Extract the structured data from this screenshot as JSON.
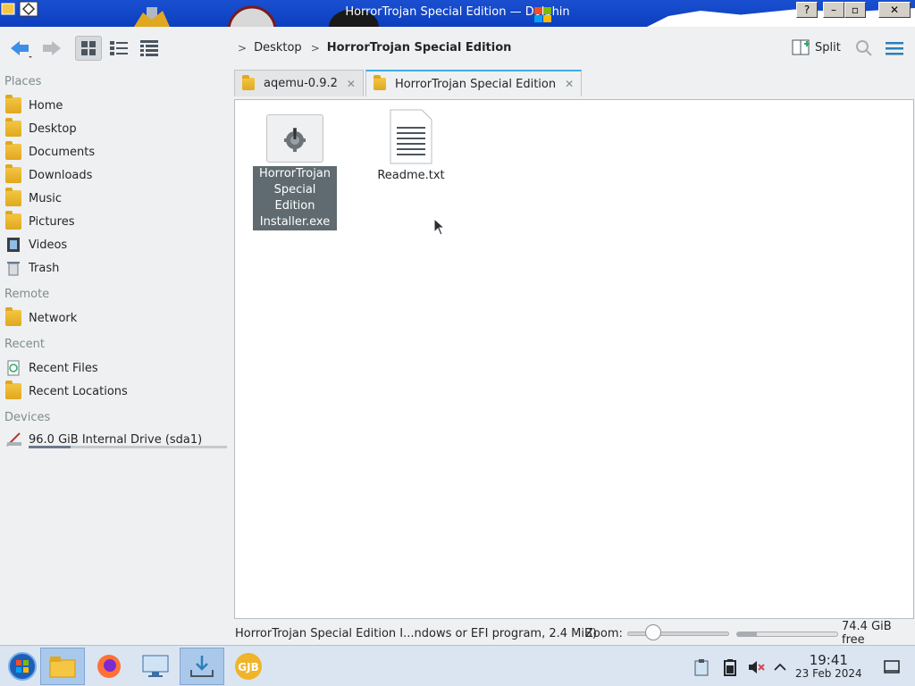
{
  "window": {
    "title": "HorrorTrojan Special Edition — Dolphin",
    "help": "?",
    "minimize": "–",
    "maximize": "▫",
    "close": "✕"
  },
  "toolbar": {
    "back_icon": "back-arrow-icon",
    "forward_icon": "forward-arrow-icon",
    "split_label": "Split"
  },
  "breadcrumb": {
    "items": [
      "Desktop",
      "HorrorTrojan Special Edition"
    ]
  },
  "sidebar": {
    "places_header": "Places",
    "places": [
      "Home",
      "Desktop",
      "Documents",
      "Downloads",
      "Music",
      "Pictures",
      "Videos",
      "Trash"
    ],
    "remote_header": "Remote",
    "remote": [
      "Network"
    ],
    "recent_header": "Recent",
    "recent": [
      "Recent Files",
      "Recent Locations"
    ],
    "devices_header": "Devices",
    "devices": [
      "96.0 GiB Internal Drive (sda1)"
    ],
    "drive_used_fraction": 0.21
  },
  "tabs": [
    {
      "label": "aqemu-0.9.2",
      "close": "✕"
    },
    {
      "label": "HorrorTrojan Special Edition",
      "close": "✕"
    }
  ],
  "files": [
    {
      "name_lines": [
        "HorrorTrojan",
        "Special Edition",
        "Installer.exe"
      ],
      "selected": true
    },
    {
      "name_lines": [
        "Readme.txt"
      ],
      "selected": false
    }
  ],
  "status": {
    "info": "HorrorTrojan Special Edition I...ndows or EFI program, 2.4 MiB)",
    "zoom_label": "Zoom:",
    "free": "74.4 GiB free",
    "free_fraction": 0.2
  },
  "taskbar": {
    "apps": [
      "start-orb",
      "file-manager",
      "firefox",
      "remote-desktop",
      "downloader",
      "gjb-app"
    ],
    "time": "19:41",
    "date": "23 Feb 2024"
  }
}
